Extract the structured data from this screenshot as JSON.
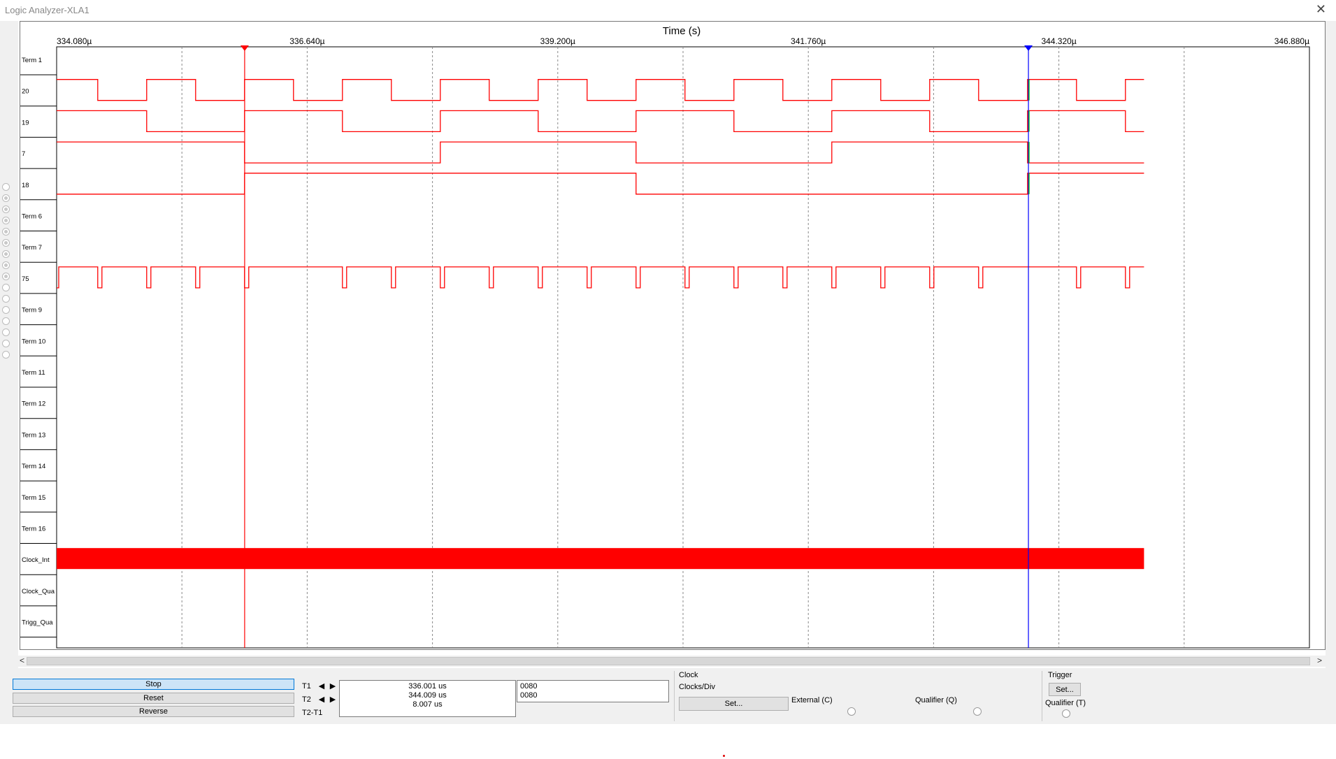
{
  "window": {
    "title": "Logic Analyzer-XLA1",
    "close_icon": "close-icon"
  },
  "plot": {
    "axis_title": "Time (s)",
    "time_labels": [
      "334.080µ",
      "336.640µ",
      "339.200µ",
      "341.760µ",
      "344.320µ",
      "346.880µ"
    ],
    "time_range": [
      334.08,
      346.88
    ],
    "data_end": 345.19,
    "cursor_t1": 336.001,
    "cursor_t2": 344.009,
    "colors": {
      "trace": "#ff0000",
      "cursor1": "#ff0000",
      "cursor2": "#0000ff",
      "grid": "#888888",
      "highlight": "#00cc00"
    },
    "channels": [
      {
        "label": "Term 1",
        "kind": "none"
      },
      {
        "label": "20",
        "kind": "square",
        "period": 1.0,
        "high_first": 334.08,
        "edges_ref": 334.51
      },
      {
        "label": "19",
        "kind": "square",
        "period": 2.0,
        "edges_ref": 335.0
      },
      {
        "label": "7",
        "kind": "square",
        "period": 4.0,
        "edges_ref": 336.0
      },
      {
        "label": "18",
        "kind": "square",
        "period": 8.0,
        "edges_ref": 336.0
      },
      {
        "label": "Term 6",
        "kind": "none"
      },
      {
        "label": "Term 7",
        "kind": "none"
      },
      {
        "label": "75",
        "kind": "pulse",
        "period": 0.5
      },
      {
        "label": "Term 9",
        "kind": "none"
      },
      {
        "label": "Term 10",
        "kind": "none"
      },
      {
        "label": "Term 11",
        "kind": "none"
      },
      {
        "label": "Term 12",
        "kind": "none"
      },
      {
        "label": "Term 13",
        "kind": "none"
      },
      {
        "label": "Term 14",
        "kind": "none"
      },
      {
        "label": "Term 15",
        "kind": "none"
      },
      {
        "label": "Term 16",
        "kind": "none"
      },
      {
        "label": "Clock_Int",
        "kind": "solid"
      },
      {
        "label": "Clock_Qua",
        "kind": "none"
      },
      {
        "label": "Trigg_Qua",
        "kind": "none"
      }
    ]
  },
  "controls": {
    "stop": "Stop",
    "reset": "Reset",
    "reverse": "Reverse",
    "t1_label": "T1",
    "t2_label": "T2",
    "t2t1_label": "T2-T1",
    "t1_value": "336.001 us",
    "t2_value": "344.009 us",
    "dt_value": "8.007 us",
    "hex_t1": "0080",
    "hex_t2": "0080",
    "left_arrow": "◀",
    "right_arrow": "▶"
  },
  "clock": {
    "title": "Clock",
    "clocks_div": "Clocks/Div",
    "set_button": "Set...",
    "external": "External (C)",
    "qualifier": "Qualifier (Q)"
  },
  "trigger": {
    "title": "Trigger",
    "set_button": "Set...",
    "qualifier": "Qualifier (T)"
  },
  "scroll": {
    "left": "<",
    "right": ">"
  }
}
